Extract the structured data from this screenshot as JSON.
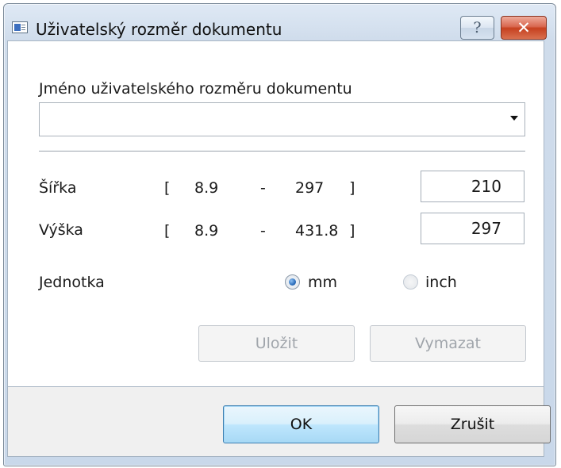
{
  "window": {
    "title": "Uživatelský rozměr dokumentu",
    "help_glyph": "?",
    "close_glyph": "✕"
  },
  "form": {
    "name_label": "Jméno uživatelského rozměru dokumentu",
    "name_value": "",
    "width": {
      "label": "Šířka",
      "bracket_open": "[",
      "min": "8.9",
      "dash": "-",
      "max": "297",
      "bracket_close": "]",
      "value": "210"
    },
    "height": {
      "label": "Výška",
      "bracket_open": "[",
      "min": "8.9",
      "dash": "-",
      "max": "431.8",
      "bracket_close": "]",
      "value": "297"
    },
    "unit": {
      "label": "Jednotka",
      "options": [
        {
          "label": "mm",
          "selected": true
        },
        {
          "label": "inch",
          "selected": false
        }
      ]
    },
    "save_label": "Uložit",
    "delete_label": "Vymazat"
  },
  "footer": {
    "ok_label": "OK",
    "cancel_label": "Zrušit"
  },
  "colors": {
    "frame": "#c9d8ea",
    "close_button": "#c6401f",
    "default_button_border": "#3c7fb1"
  }
}
